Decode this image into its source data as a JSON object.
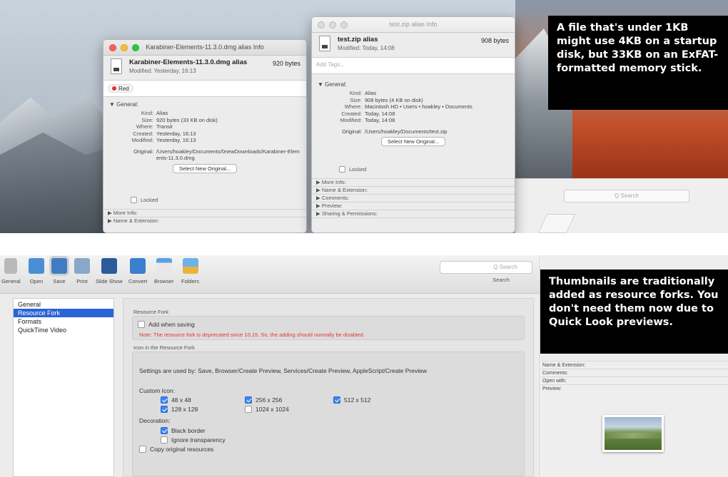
{
  "top_panel": {
    "search_placeholder": "Q Search",
    "window_karabiner": {
      "title": "Karabiner-Elements-11.3.0.dmg alias Info",
      "name": "Karabiner-Elements-11.3.0.dmg alias",
      "size": "920 bytes",
      "modified": "Modified: Yesterday, 16:13",
      "tag": "Red",
      "general_header": "▼ General:",
      "fields": [
        {
          "k": "Kind:",
          "v": "Alias"
        },
        {
          "k": "Size:",
          "v": "920 bytes (33 KB on disk)"
        },
        {
          "k": "Where:",
          "v": "Transit"
        },
        {
          "k": "Created:",
          "v": "Yesterday, 16:13"
        },
        {
          "k": "Modified:",
          "v": "Yesterday, 16:13"
        }
      ],
      "original_label": "Original:",
      "original_value": "/Users/hoakley/Documents/0newDownloads/Karabiner-Elements-11.3.0.dmg",
      "select_button": "Select New Original...",
      "locked_label": "Locked",
      "more_info": "▶ More Info:",
      "name_ext": "▶ Name & Extension:"
    },
    "window_testzip": {
      "title": "test.zip alias Info",
      "name": "test.zip alias",
      "size": "908 bytes",
      "modified": "Modified: Today, 14:08",
      "tags_placeholder": "Add Tags...",
      "general_header": "▼ General:",
      "fields": [
        {
          "k": "Kind:",
          "v": "Alias"
        },
        {
          "k": "Size:",
          "v": "908 bytes (4 KB on disk)"
        },
        {
          "k": "Where:",
          "v": "Macintosh HD • Users • hoakley • Documents"
        },
        {
          "k": "Created:",
          "v": "Today, 14:08"
        },
        {
          "k": "Modified:",
          "v": "Today, 14:08"
        }
      ],
      "original_label": "Original:",
      "original_value": "/Users/hoakley/Documents/test.zip",
      "select_button": "Select New Original...",
      "locked_label": "Locked",
      "sections": [
        "▶ More Info:",
        "▶ Name & Extension:",
        "▶ Comments:",
        "▶ Preview:",
        "▶ Sharing & Permissions:"
      ]
    },
    "callout": "A file that's under 1KB might use 4KB on a startup disk, but 33KB on an ExFAT-formatted memory stick."
  },
  "bottom_panel": {
    "toolbar": {
      "items": [
        "General",
        "Open",
        "Save",
        "Print",
        "Slide Show",
        "Convert",
        "Browser",
        "Folders"
      ],
      "selected": "Save",
      "search_placeholder": "Q Search",
      "search_label": "Search"
    },
    "sidebar": {
      "items": [
        "General",
        "Resource Fork",
        "Formats",
        "QuickTime Video"
      ],
      "selected_index": 1
    },
    "content": {
      "resource_fork_label": "Resource Fork",
      "add_when_saving": "Add when saving",
      "note": "Note: The resource fork is deprecated since 10.15. So, the adding should normally be disabled.",
      "icon_group_label": "Icon in the Resource Fork",
      "settings_used_by": "Settings are used by: Save, Browser/Create Preview, Services/Create Preview, AppleScript/Create Preview",
      "custom_icon_label": "Custom Icon:",
      "sizes": [
        {
          "label": "48 x 48",
          "checked": true
        },
        {
          "label": "256 x 256",
          "checked": true
        },
        {
          "label": "512 x 512",
          "checked": true
        },
        {
          "label": "128 x 128",
          "checked": true
        },
        {
          "label": "1024 x 1024",
          "checked": false
        }
      ],
      "decoration_label": "Decoration:",
      "black_border": "Black border",
      "ignore_transparency": "Ignore transparency",
      "copy_original": "Copy original resources"
    },
    "callout": "Thumbnails are traditionally added as resource forks. You don't need them now due to Quick Look previews.",
    "info_rows": [
      "Name & Extension:",
      "Comments:",
      "Open with:",
      "Preview:"
    ]
  },
  "colors": {
    "accent": "#2a64d6",
    "checkbox_on": "#3a86f2",
    "tag_red": "#e0322c",
    "note_red": "#e03a2e",
    "callout_bg": "#000000"
  }
}
